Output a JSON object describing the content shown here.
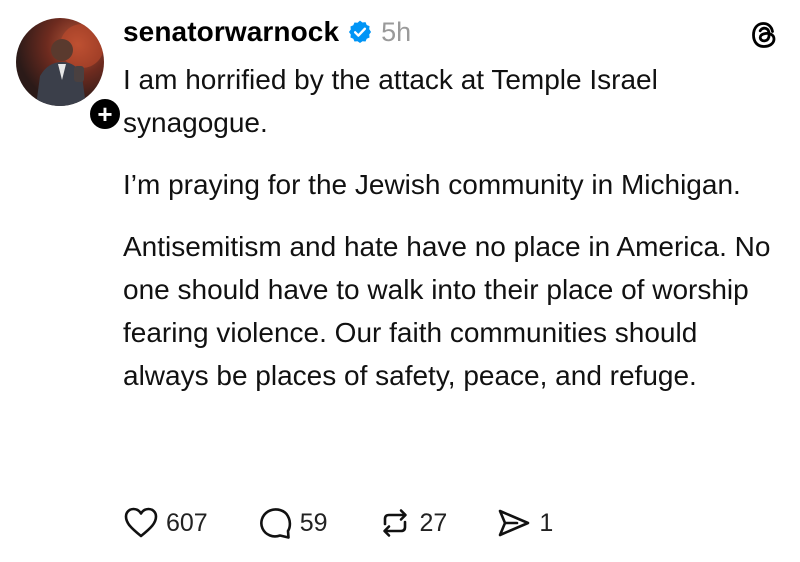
{
  "post": {
    "username": "senatorwarnock",
    "timestamp": "5h",
    "verified_icon": "verified-badge-icon",
    "follow_icon": "plus-icon",
    "app_icon": "threads-logo-icon",
    "paragraphs": [
      "I am horrified by the attack at Temple Israel synagogue.",
      "I’m praying for the Jewish community in Michigan.",
      "Antisemitism and hate have no place in America. No one should have to walk into their place of worship fearing violence. Our faith communities should always be places of safety, peace, and refuge."
    ]
  },
  "actions": {
    "likes": "607",
    "replies": "59",
    "reposts": "27",
    "shares": "1"
  },
  "colors": {
    "verified_blue": "#0095f6",
    "muted_text": "#9a9a9a"
  }
}
